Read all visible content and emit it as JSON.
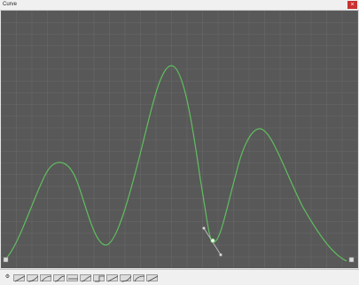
{
  "window": {
    "title": "Curve",
    "close_glyph": "×"
  },
  "colors": {
    "canvas_bg": "#585858",
    "grid": "#6a6a6a",
    "curve": "#5fbf5f",
    "tangent": "#c8c8c8"
  },
  "toolbar": {
    "settings_icon": "gear-icon",
    "presets": [
      "linear",
      "ease-in",
      "ease-out",
      "ease-in-out",
      "constant",
      "ease-in-out-2",
      "step",
      "linear-2",
      "ease-in-2",
      "ease-out-2",
      "linear-3"
    ]
  }
}
